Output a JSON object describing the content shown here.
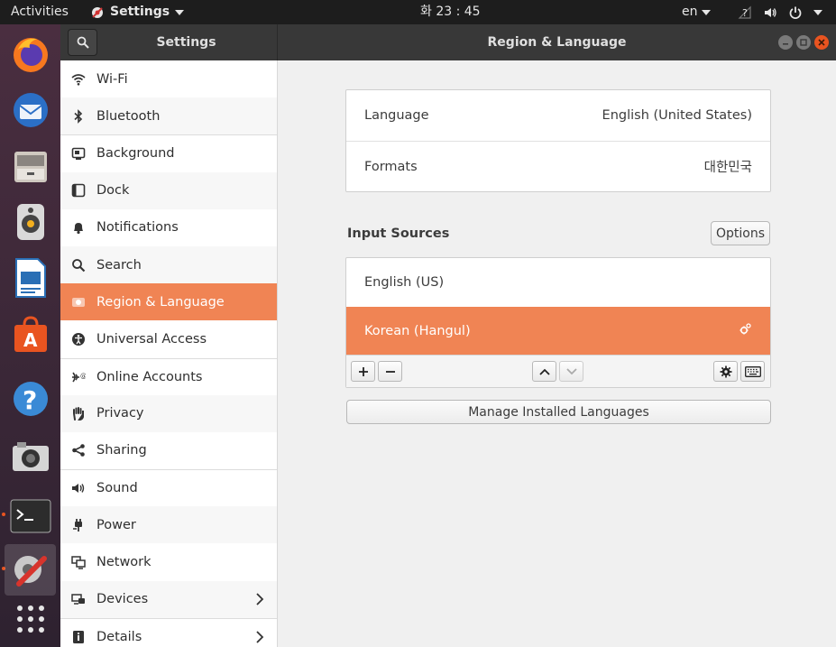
{
  "topbar": {
    "activities": "Activities",
    "app_name": "Settings",
    "clock": "화 23 : 45",
    "lang": "en"
  },
  "window": {
    "sidebar_title": "Settings",
    "title": "Region & Language"
  },
  "sidebar": {
    "items": [
      {
        "label": "Wi-Fi",
        "icon": "wifi-icon"
      },
      {
        "label": "Bluetooth",
        "icon": "bluetooth-icon"
      },
      {
        "label": "Background",
        "icon": "background-icon"
      },
      {
        "label": "Dock",
        "icon": "dock-icon"
      },
      {
        "label": "Notifications",
        "icon": "bell-icon"
      },
      {
        "label": "Search",
        "icon": "search-icon"
      },
      {
        "label": "Region & Language",
        "icon": "region-icon"
      },
      {
        "label": "Universal Access",
        "icon": "accessibility-icon"
      },
      {
        "label": "Online Accounts",
        "icon": "online-accounts-icon"
      },
      {
        "label": "Privacy",
        "icon": "hand-icon"
      },
      {
        "label": "Sharing",
        "icon": "share-icon"
      },
      {
        "label": "Sound",
        "icon": "speaker-icon"
      },
      {
        "label": "Power",
        "icon": "power-plug-icon"
      },
      {
        "label": "Network",
        "icon": "network-icon"
      },
      {
        "label": "Devices",
        "icon": "devices-icon"
      },
      {
        "label": "Details",
        "icon": "info-icon"
      }
    ]
  },
  "region": {
    "language_label": "Language",
    "language_value": "English (United States)",
    "formats_label": "Formats",
    "formats_value": "대한민국",
    "input_sources_title": "Input Sources",
    "options_label": "Options",
    "sources": [
      {
        "name": "English (US)"
      },
      {
        "name": "Korean (Hangul)"
      }
    ],
    "manage_label": "Manage Installed Languages"
  },
  "colors": {
    "accent": "#f08454",
    "topbar_bg": "#1d1d1d",
    "header_bg": "#383838"
  }
}
